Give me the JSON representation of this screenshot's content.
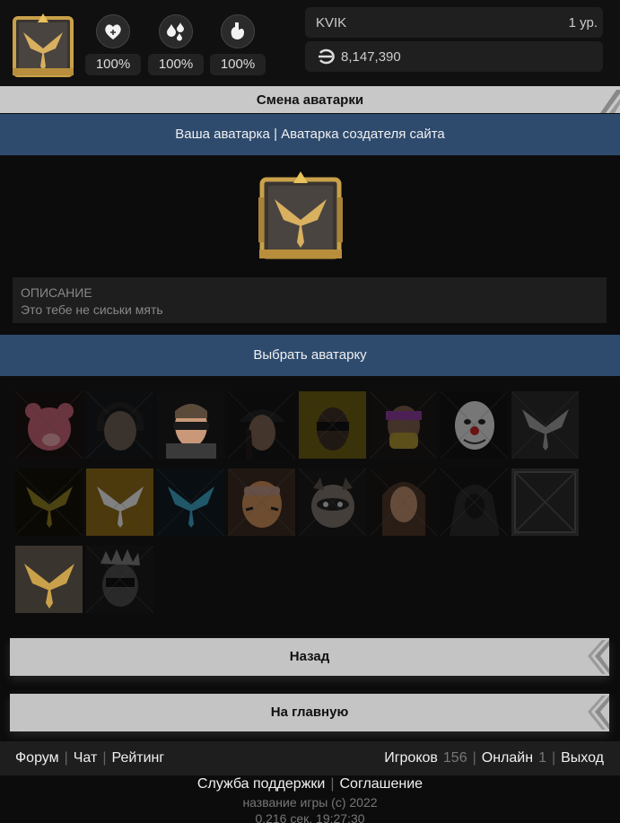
{
  "header": {
    "avatar_icon": "golden-bird-emblem-icon",
    "stats": [
      {
        "name": "health",
        "icon": "heart-icon",
        "value": "100%"
      },
      {
        "name": "water",
        "icon": "water-drops-icon",
        "value": "100%"
      },
      {
        "name": "food",
        "icon": "stomach-icon",
        "value": "100%"
      }
    ],
    "player_name": "KVIK",
    "player_level": "1 ур.",
    "money_icon": "currency-icon",
    "money": "8,147,390"
  },
  "page_title": "Смена аватарки",
  "tabs": {
    "own": "Ваша аватарка",
    "separator": "|",
    "creator": "Аватарка создателя сайта"
  },
  "description": {
    "label": "ОПИСАНИЕ",
    "text": "Это тебе не сиськи мять"
  },
  "choose_label": "Выбрать аватарку",
  "avatars": [
    {
      "name": "pink-bear",
      "locked": true
    },
    {
      "name": "soldier-headset",
      "locked": true
    },
    {
      "name": "soldier-goggles",
      "locked": false
    },
    {
      "name": "woman-cap",
      "locked": true
    },
    {
      "name": "visor-yellow",
      "locked": true
    },
    {
      "name": "gasmask-visor",
      "locked": true
    },
    {
      "name": "clown-mask",
      "locked": true
    },
    {
      "name": "silver-bird",
      "locked": true
    },
    {
      "name": "dark-gold-bird",
      "locked": true
    },
    {
      "name": "gold-bird",
      "locked": true
    },
    {
      "name": "teal-bird",
      "locked": true
    },
    {
      "name": "tiger-operator",
      "locked": true
    },
    {
      "name": "raccoon",
      "locked": true
    },
    {
      "name": "woman-portrait",
      "locked": true
    },
    {
      "name": "hooded-figure",
      "locked": true
    },
    {
      "name": "metal-plate",
      "locked": true
    },
    {
      "name": "bronze-bird",
      "locked": false
    },
    {
      "name": "masked-crown",
      "locked": true
    }
  ],
  "buttons": {
    "back": "Назад",
    "home": "На главную"
  },
  "footer": {
    "forum": "Форум",
    "chat": "Чат",
    "rating": "Рейтинг",
    "players_label": "Игроков",
    "players_count": "156",
    "online_label": "Онлайн",
    "online_count": "1",
    "logout": "Выход",
    "support": "Служба поддержки",
    "agreement": "Соглашение",
    "copyright": "название игры (c) 2022",
    "timing": "0.216 сек.   19:27:30"
  },
  "colors": {
    "accent_blue": "#2e4b6e",
    "gold": "#c9a14a",
    "bar_gray": "#c4c4c4"
  }
}
